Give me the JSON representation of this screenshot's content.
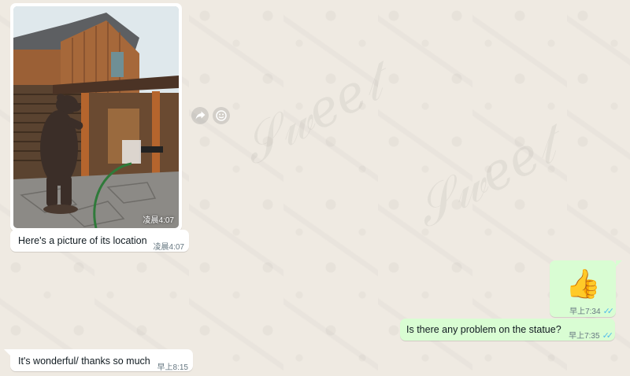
{
  "chat": {
    "messages": [
      {
        "id": "photo",
        "direction": "incoming",
        "media": "photo",
        "photo_description_icon": "bear-statue-cabin-photo",
        "time": "凌晨4:07"
      },
      {
        "id": "location",
        "direction": "incoming",
        "text": "Here's a picture of its location",
        "time": "凌晨4:07"
      },
      {
        "id": "thumbs",
        "direction": "outgoing",
        "emoji": "👍",
        "time": "早上7:34",
        "status": "read"
      },
      {
        "id": "problem",
        "direction": "outgoing",
        "text": "Is there any problem on the statue?",
        "time": "早上7:35",
        "status": "read"
      },
      {
        "id": "wonderful",
        "direction": "incoming",
        "text": "It's wonderful/ thanks so much",
        "time": "早上8:15"
      }
    ]
  },
  "actions": {
    "forward_icon": "forward-icon",
    "react_icon": "emoji-react-icon"
  },
  "colors": {
    "wallpaper": "#efeae2",
    "incoming_bubble": "#ffffff",
    "outgoing_bubble": "#d9fdd3",
    "read_ticks": "#53bdeb",
    "meta_text": "#667781"
  }
}
